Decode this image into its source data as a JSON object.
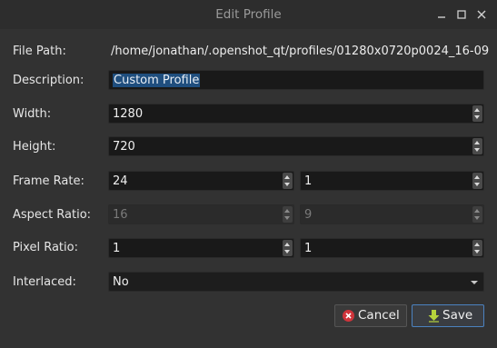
{
  "window": {
    "title": "Edit Profile"
  },
  "labels": {
    "file_path": "File Path:",
    "description": "Description:",
    "width": "Width:",
    "height": "Height:",
    "frame_rate": "Frame Rate:",
    "aspect_ratio": "Aspect Ratio:",
    "pixel_ratio": "Pixel Ratio:",
    "interlaced": "Interlaced:"
  },
  "fields": {
    "file_path": "/home/jonathan/.openshot_qt/profiles/01280x0720p0024_16-09",
    "description": "Custom Profile",
    "width": "1280",
    "height": "720",
    "frame_rate_num": "24",
    "frame_rate_den": "1",
    "aspect_ratio_num": "16",
    "aspect_ratio_den": "9",
    "pixel_ratio_num": "1",
    "pixel_ratio_den": "1",
    "interlaced": "No"
  },
  "buttons": {
    "cancel": "Cancel",
    "save": "Save"
  },
  "icons": {
    "minimize": "minimize-icon",
    "maximize": "maximize-icon",
    "close": "close-icon",
    "cancel": "cancel-icon",
    "save": "save-arrow-icon"
  },
  "colors": {
    "accent": "#4b82c0",
    "selection": "#1f4e7e",
    "cancel_icon": "#d0343b",
    "save_icon": "#b6d43c"
  }
}
